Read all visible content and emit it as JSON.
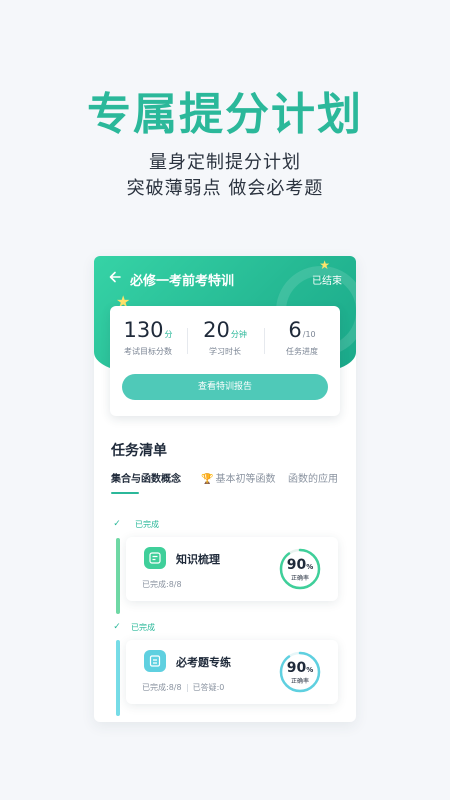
{
  "hero": {
    "title": "专属提分计划",
    "subtitle_line1": "量身定制提分计划",
    "subtitle_line2": "突破薄弱点 做会必考题"
  },
  "nav": {
    "back_icon": "arrow-left-icon",
    "title": "必修一考前考特训",
    "status": "已结束"
  },
  "stats": [
    {
      "value": "130",
      "unit": "分",
      "label": "考试目标分数"
    },
    {
      "value": "20",
      "unit": "分钟",
      "label": "学习时长"
    },
    {
      "value": "6",
      "unit": "/10",
      "label": "任务进度"
    }
  ],
  "report_button": "查看特训报告",
  "task_section": {
    "title": "任务清单",
    "tabs": [
      "集合与函数概念",
      "基本初等函数",
      "函数的应用"
    ],
    "active_tab": 0
  },
  "tasks": [
    {
      "status": "已完成",
      "name": "知识梳理",
      "meta1": "已完成:8/8",
      "meta2": "",
      "accuracy_pct": 90,
      "accuracy_value": "90",
      "accuracy_unit": "%",
      "accuracy_label": "正确率",
      "icon": "notes-icon",
      "color": "#3fcf9a"
    },
    {
      "status": "已完成",
      "name": "必考题专练",
      "meta1": "已完成:8/8",
      "meta2": "已答疑:0",
      "accuracy_pct": 90,
      "accuracy_value": "90",
      "accuracy_unit": "%",
      "accuracy_label": "正确率",
      "icon": "exercise-book-icon",
      "color": "#5fd0e0"
    }
  ],
  "colors": {
    "brand": "#2bb89a",
    "button": "#4fc9b8",
    "trophy": "#f0a43a",
    "star": "#ffe36b"
  }
}
